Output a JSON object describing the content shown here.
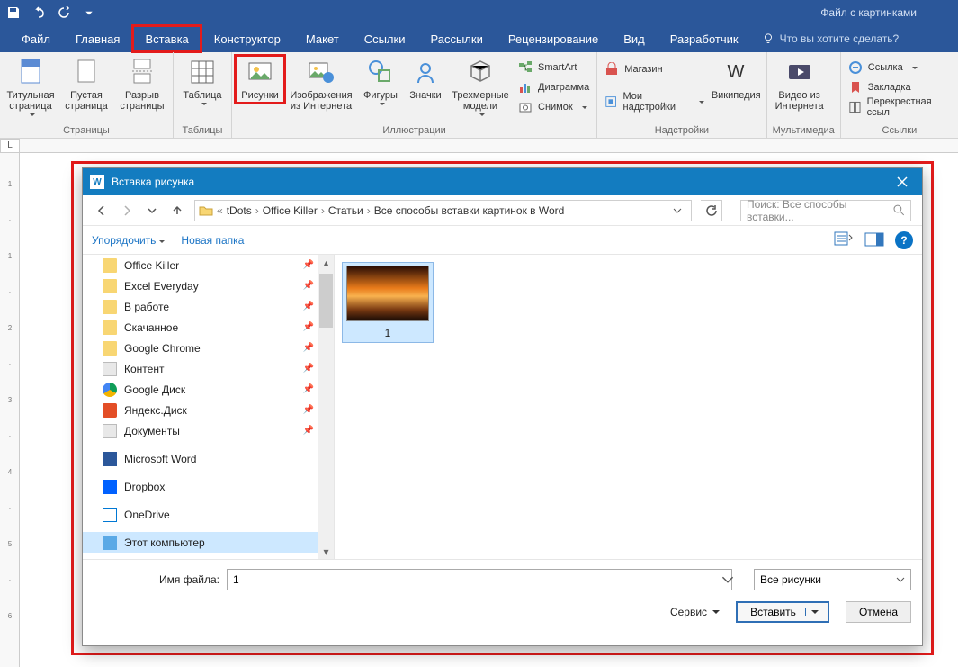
{
  "titlebar": {
    "doc_title": "Файл с картинками"
  },
  "tabs": {
    "file": "Файл",
    "home": "Главная",
    "insert": "Вставка",
    "design": "Конструктор",
    "layout": "Макет",
    "references": "Ссылки",
    "mailings": "Рассылки",
    "review": "Рецензирование",
    "view": "Вид",
    "developer": "Разработчик",
    "tell_me": "Что вы хотите сделать?"
  },
  "ribbon": {
    "pages": {
      "cover": "Титульная страница",
      "blank": "Пустая страница",
      "break": "Разрыв страницы",
      "group": "Страницы"
    },
    "tables": {
      "table": "Таблица",
      "group": "Таблицы"
    },
    "ill": {
      "pictures": "Рисунки",
      "online": "Изображения из Интернета",
      "shapes": "Фигуры",
      "icons": "Значки",
      "models3d": "Трехмерные модели",
      "smartart": "SmartArt",
      "chart": "Диаграмма",
      "screenshot": "Снимок",
      "group": "Иллюстрации"
    },
    "addins": {
      "store": "Магазин",
      "my": "Мои надстройки",
      "wiki": "Википедия",
      "group": "Надстройки"
    },
    "media": {
      "video": "Видео из Интернета",
      "group": "Мультимедиа"
    },
    "links": {
      "link": "Ссылка",
      "bookmark": "Закладка",
      "xref": "Перекрестная ссыл",
      "group": "Ссылки"
    }
  },
  "ruler_corner": "L",
  "dialog": {
    "title": "Вставка рисунка",
    "nav": {
      "crumbs": [
        "tDots",
        "Office Killer",
        "Статьи",
        "Все способы вставки картинок в Word"
      ],
      "search_placeholder": "Поиск: Все способы вставки..."
    },
    "toolbar": {
      "organize": "Упорядочить",
      "newfolder": "Новая папка"
    },
    "tree": [
      {
        "icon": "folder",
        "label": "Office Killer",
        "pin": true
      },
      {
        "icon": "folder",
        "label": "Excel Everyday",
        "pin": true
      },
      {
        "icon": "folder",
        "label": "В работе",
        "pin": true
      },
      {
        "icon": "folder",
        "label": "Скачанное",
        "pin": true
      },
      {
        "icon": "folder",
        "label": "Google Chrome",
        "pin": true
      },
      {
        "icon": "doc",
        "label": "Контент",
        "pin": true
      },
      {
        "icon": "gd",
        "label": "Google Диск",
        "pin": true
      },
      {
        "icon": "yd",
        "label": "Яндекс.Диск",
        "pin": true
      },
      {
        "icon": "doc",
        "label": "Документы",
        "pin": true
      },
      {
        "icon": "wrd",
        "label": "Microsoft Word",
        "pin": false
      },
      {
        "icon": "db",
        "label": "Dropbox",
        "pin": false
      },
      {
        "icon": "od",
        "label": "OneDrive",
        "pin": false
      },
      {
        "icon": "pc",
        "label": "Этот компьютер",
        "pin": false,
        "selected": true
      }
    ],
    "files": [
      {
        "name": "1"
      }
    ],
    "bottom": {
      "filename_label": "Имя файла:",
      "filename_value": "1",
      "type_value": "Все рисунки",
      "service": "Сервис",
      "insert": "Вставить",
      "cancel": "Отмена"
    }
  }
}
